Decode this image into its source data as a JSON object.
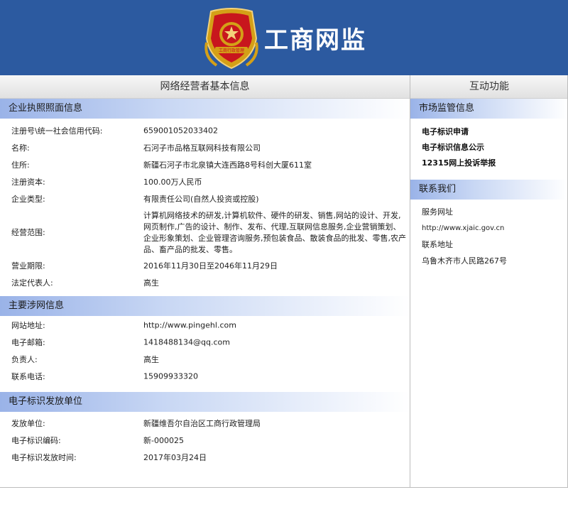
{
  "header": {
    "site_title": "工商网监",
    "emblem_text": "工商行政管理"
  },
  "left": {
    "heading": "网络经营者基本信息",
    "license_section": {
      "title": "企业执照照面信息",
      "rows": [
        {
          "key": "注册号\\统一社会信用代码:",
          "value": "659001052033402"
        },
        {
          "key": "名称:",
          "value": "石河子市品格互联网科技有限公司"
        },
        {
          "key": "住所:",
          "value": "新疆石河子市北泉镇大连西路8号科创大厦611室"
        },
        {
          "key": "注册资本:",
          "value": "100.00万人民币"
        },
        {
          "key": "企业类型:",
          "value": "有限责任公司(自然人投资或控股)"
        }
      ],
      "scope": {
        "key": "经营范围:",
        "value": "计算机网络技术的研发,计算机软件、硬件的研发、销售,网站的设计、开发,网页制作,广告的设计、制作、发布、代理,互联网信息服务,企业营销策划、企业形象策划、企业管理咨询服务,预包装食品、散装食品的批发、零售,农产品、畜产品的批发、零售。"
      },
      "rows2": [
        {
          "key": "营业期限:",
          "value": "2016年11月30日至2046年11月29日"
        },
        {
          "key": "法定代表人:",
          "value": "高生"
        }
      ]
    },
    "web_section": {
      "title": "主要涉网信息",
      "rows": [
        {
          "key": "网站地址:",
          "value": "http://www.pingehl.com"
        },
        {
          "key": "电子邮箱:",
          "value": "1418488134@qq.com"
        },
        {
          "key": "负责人:",
          "value": "高生"
        },
        {
          "key": "联系电话:",
          "value": "15909933320"
        }
      ]
    },
    "issuer_section": {
      "title": "电子标识发放单位",
      "rows": [
        {
          "key": "发放单位:",
          "value": "新疆维吾尔自治区工商行政管理局"
        },
        {
          "key": "电子标识编码:",
          "value": "新-000025"
        },
        {
          "key": "电子标识发放时间:",
          "value": "2017年03月24日"
        }
      ]
    }
  },
  "right": {
    "heading": "互动功能",
    "supervision": {
      "title": "市场监管信息",
      "links": [
        "电子标识申请",
        "电子标识信息公示",
        "12315网上投诉举报"
      ]
    },
    "contact": {
      "title": "联系我们",
      "service_label": "服务网址",
      "service_url": "http://www.xjaic.gov.cn",
      "address_label": "联系地址",
      "address": "乌鲁木齐市人民路267号"
    }
  },
  "colors": {
    "header_bg": "#2c5aa0",
    "section_gradient_start": "#9ab3e8",
    "divider": "#bcbcbc"
  }
}
